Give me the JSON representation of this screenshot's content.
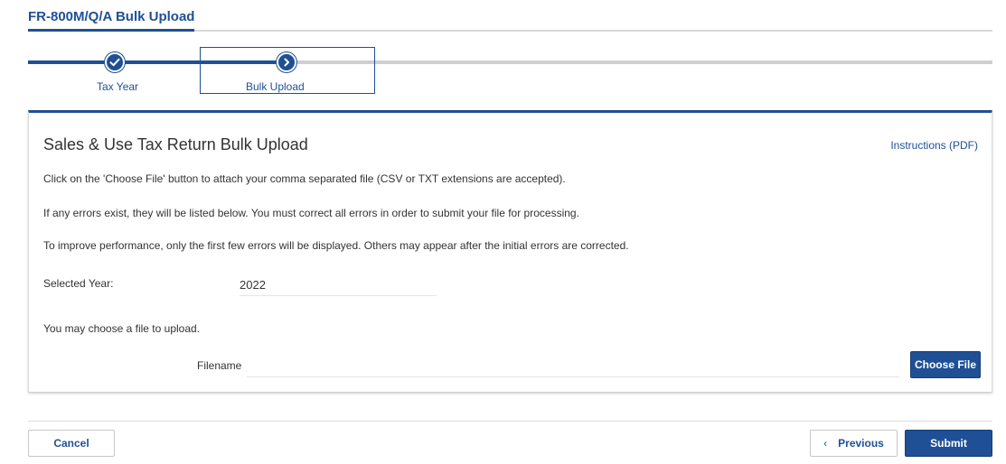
{
  "header": {
    "title": "FR-800M/Q/A Bulk Upload"
  },
  "stepper": {
    "steps": [
      {
        "label": "Tax Year",
        "icon": "check-icon",
        "status": "complete"
      },
      {
        "label": "Bulk Upload",
        "icon": "chevron-right-icon",
        "status": "active"
      }
    ]
  },
  "card": {
    "title": "Sales & Use Tax Return Bulk Upload",
    "instructions_link": "Instructions (PDF)",
    "paragraphs": [
      "Click on the 'Choose File' button to attach your comma separated file (CSV or TXT extensions are accepted).",
      "If any errors exist, they will be listed below. You must correct all errors in order to submit your file for processing.",
      "To improve performance, only the first few errors will be displayed. Others may appear after the initial errors are corrected."
    ],
    "selected_year_label": "Selected Year:",
    "selected_year_value": "2022",
    "choose_text": "You may choose a file to upload.",
    "filename_label": "Filename",
    "filename_value": "",
    "choose_file_button": "Choose File"
  },
  "footer": {
    "cancel": "Cancel",
    "previous": "Previous",
    "submit": "Submit"
  },
  "colors": {
    "accent": "#1f5096",
    "rule": "#d9d9d9",
    "text": "#333333"
  }
}
